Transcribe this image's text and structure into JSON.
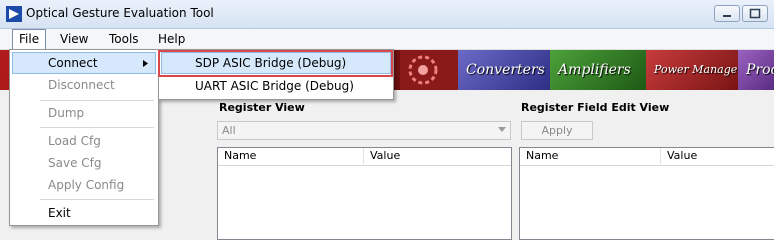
{
  "window": {
    "title": "Optical Gesture Evaluation Tool"
  },
  "menubar": {
    "items": [
      "File",
      "View",
      "Tools",
      "Help"
    ]
  },
  "banner": {
    "tiles": [
      "",
      "Converters",
      "Amplifiers",
      "Power Management",
      "Proc"
    ]
  },
  "file_menu": {
    "connect": "Connect",
    "disconnect": "Disconnect",
    "dump": "Dump",
    "load_cfg": "Load Cfg",
    "save_cfg": "Save Cfg",
    "apply_config": "Apply Config",
    "exit": "Exit"
  },
  "connect_submenu": {
    "items": [
      "SDP ASIC Bridge (Debug)",
      "UART ASIC Bridge (Debug)"
    ]
  },
  "register_view": {
    "label": "Register View",
    "filter_value": "All",
    "columns": [
      "Name",
      "Value"
    ]
  },
  "field_edit_view": {
    "label": "Register Field Edit View",
    "apply_label": "Apply",
    "columns": [
      "Name",
      "Value"
    ]
  }
}
